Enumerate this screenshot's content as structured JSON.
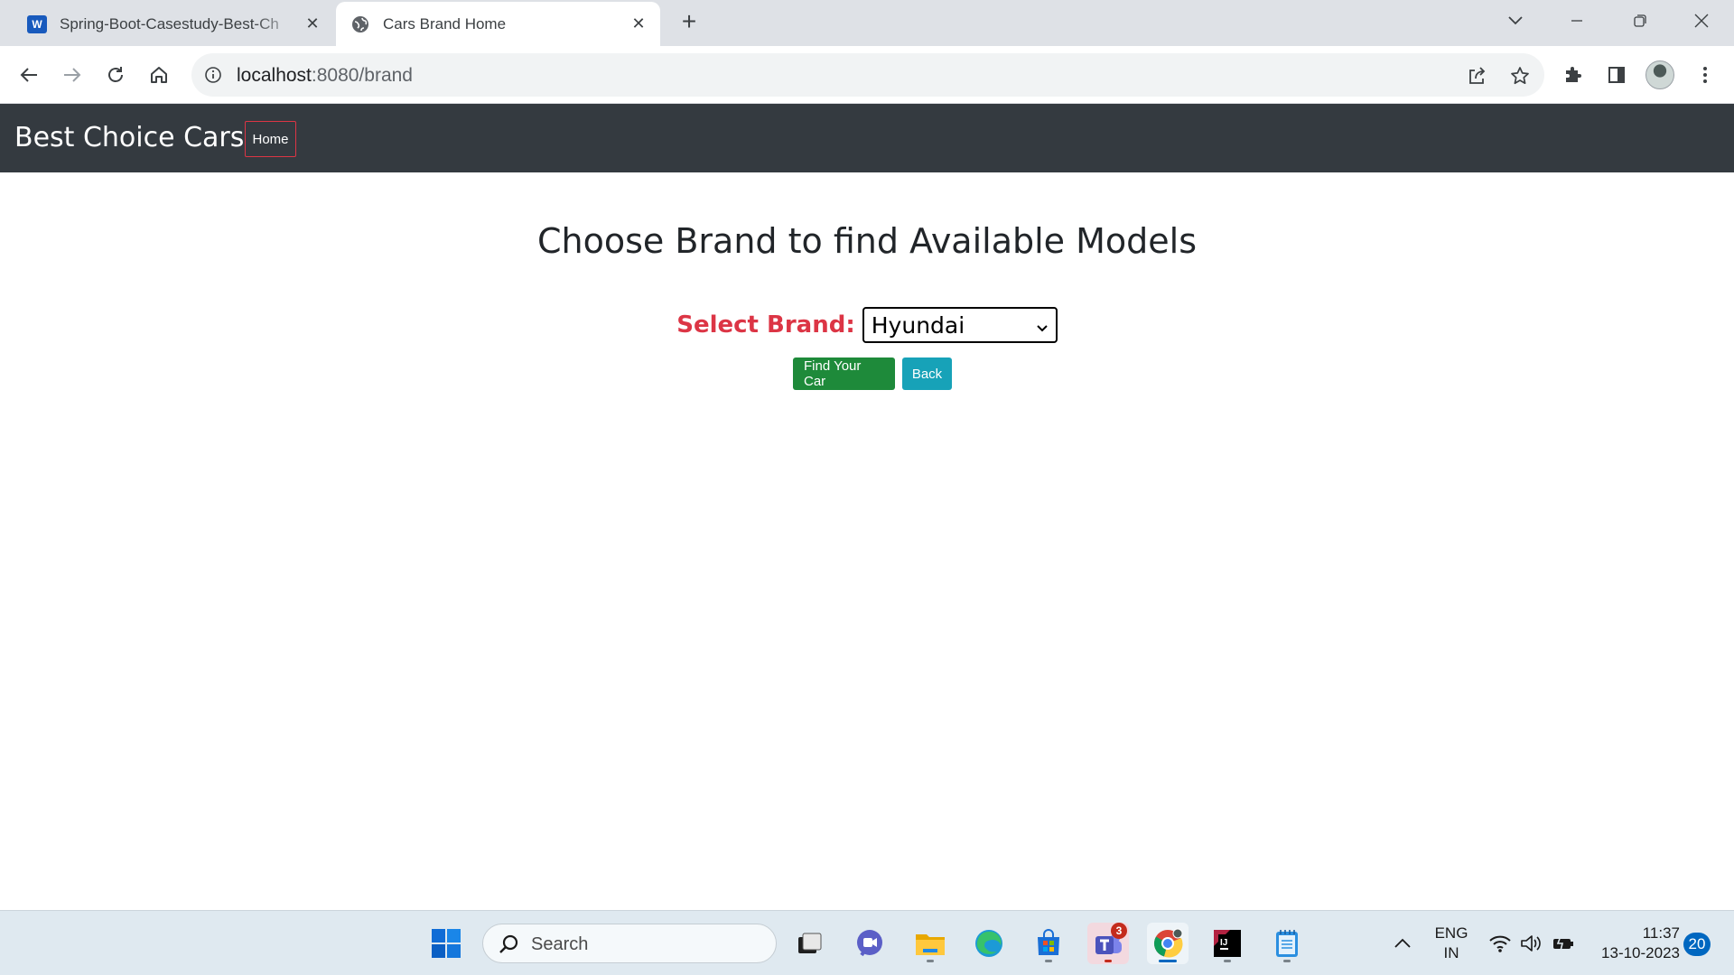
{
  "browser": {
    "tabs": [
      {
        "title": "Spring-Boot-Casestudy-Best-Ch",
        "icon": "word-icon",
        "active": false
      },
      {
        "title": "Cars Brand Home",
        "icon": "globe-icon",
        "active": true
      }
    ],
    "address": {
      "host": "localhost",
      "path": ":8080/brand"
    }
  },
  "app": {
    "brand": "Best Choice Cars",
    "nav_home": "Home",
    "heading": "Choose Brand to find Available Models",
    "select_label": "Select Brand:",
    "selected_brand": "Hyundai",
    "find_button": "Find Your Car",
    "back_button": "Back"
  },
  "taskbar": {
    "search_placeholder": "Search",
    "teams_badge": "3",
    "lang_line1": "ENG",
    "lang_line2": "IN",
    "time": "11:37",
    "date": "13-10-2023",
    "notifications": "20"
  },
  "colors": {
    "navbar": "#343a40",
    "label_red": "#dc3545",
    "btn_success": "#1e8a3a",
    "btn_info": "#17a2b8"
  }
}
